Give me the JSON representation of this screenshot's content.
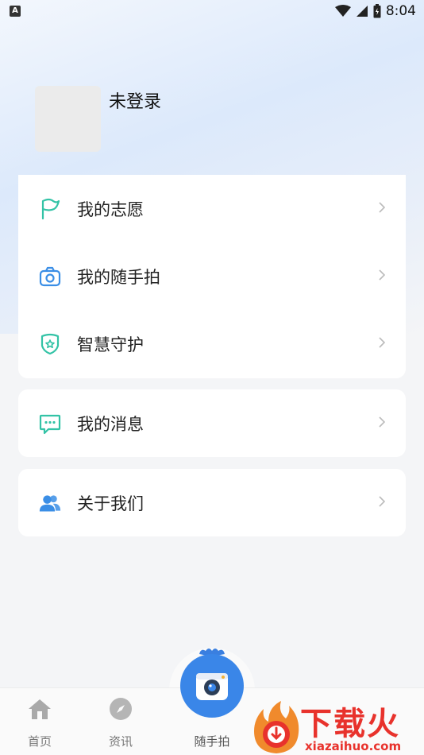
{
  "status_bar": {
    "left_badge": "A",
    "time": "8:04"
  },
  "profile": {
    "username": "未登录"
  },
  "menu": {
    "group1": [
      {
        "label": "我的志愿",
        "icon": "flag-icon"
      },
      {
        "label": "我的随手拍",
        "icon": "camera-icon"
      },
      {
        "label": "智慧守护",
        "icon": "shield-star-icon"
      }
    ],
    "group2": [
      {
        "label": "我的消息",
        "icon": "message-icon"
      }
    ],
    "group3": [
      {
        "label": "关于我们",
        "icon": "users-icon"
      }
    ]
  },
  "bottom_nav": {
    "items": [
      {
        "label": "首页",
        "icon": "home-icon"
      },
      {
        "label": "资讯",
        "icon": "compass-icon"
      },
      {
        "label": "随手拍",
        "icon": "camera-icon"
      }
    ]
  },
  "watermark": {
    "text": "下载火",
    "url": "xiazaihuo.com"
  },
  "colors": {
    "accent_teal": "#33c3a6",
    "accent_blue": "#3a8ee6",
    "watermark_red": "#e8322c"
  }
}
